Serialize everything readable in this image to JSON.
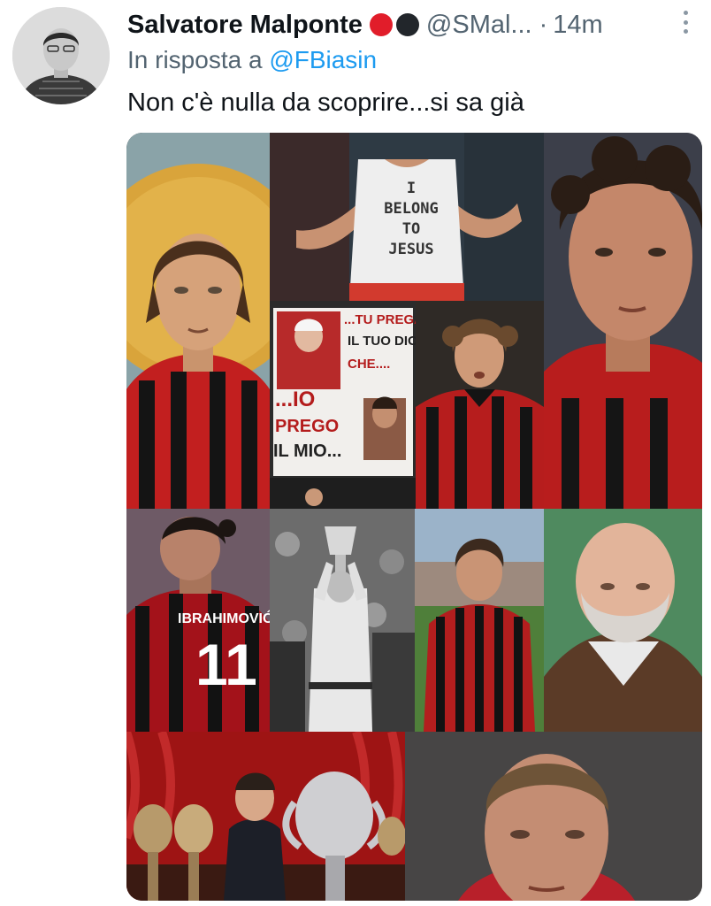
{
  "tweet": {
    "author_name": "Salvatore Malponte",
    "handle": "@SMal...",
    "separator": "·",
    "time": "14m",
    "reply_prefix": "In risposta a",
    "reply_mention": "@FBiasin",
    "body": "Non c'è nulla da scoprire...si sa già",
    "badge_colors": [
      "#e11d2a",
      "#22262b"
    ],
    "accent": "#1d9bf0"
  },
  "media": {
    "shirt_text": [
      "I",
      "BELONG",
      "TO",
      "JESUS"
    ],
    "banner_lines": [
      "...TU PREGA",
      "IL TUO DIO,",
      "CHE....",
      "...IO",
      "PREGO",
      "IL MIO..."
    ],
    "jersey_name": "IBRAHIMOVIĆ",
    "jersey_number": "11"
  }
}
